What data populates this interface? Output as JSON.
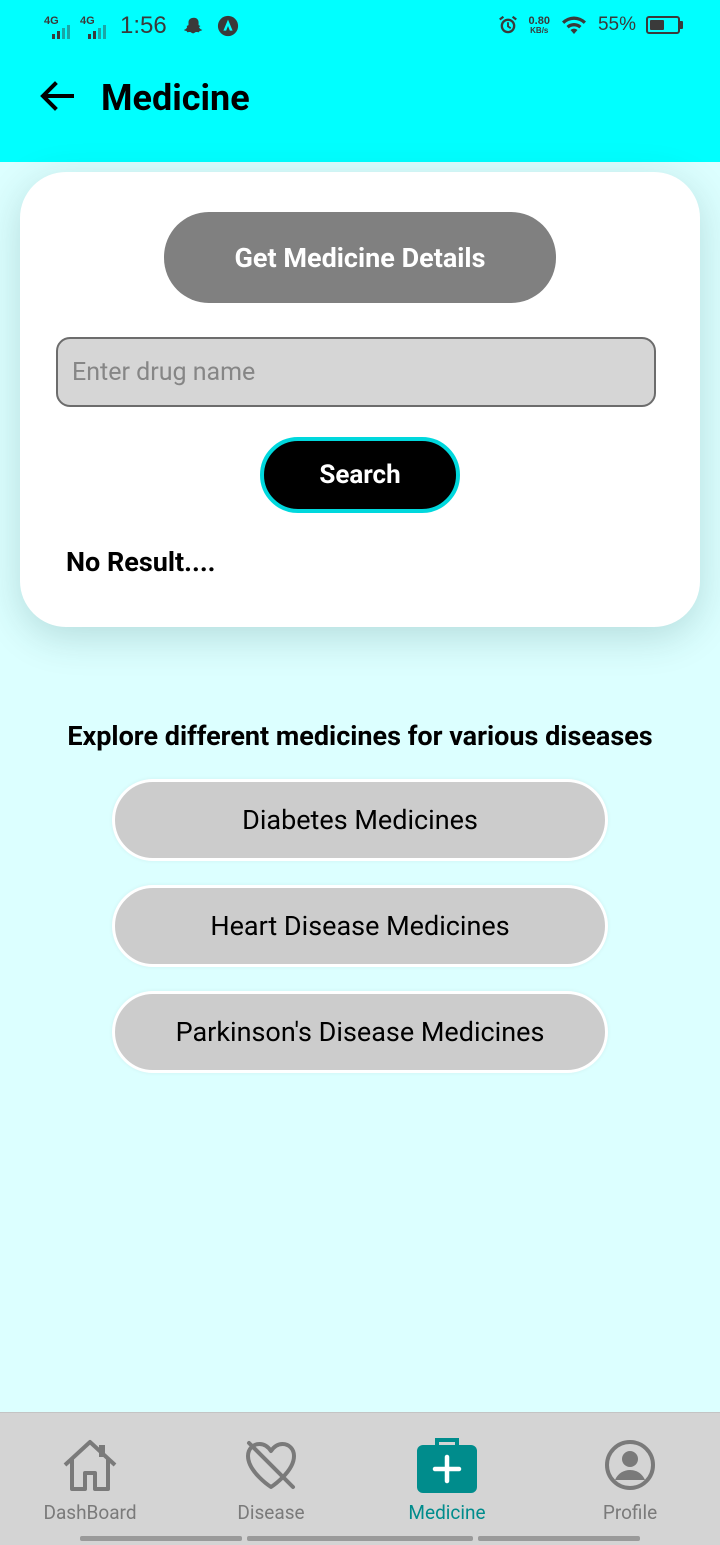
{
  "status_bar": {
    "network_1": "4G",
    "network_2": "4G",
    "time": "1:56",
    "net_speed_value": "0.80",
    "net_speed_unit": "KB/s",
    "battery_percent": "55%",
    "battery_level": 0.55
  },
  "header": {
    "title": "Medicine",
    "back_icon": "arrow-left-icon",
    "background_color": "#00ffff"
  },
  "search_card": {
    "details_button_label": "Get Medicine Details",
    "input_placeholder": "Enter drug name",
    "input_value": "",
    "search_button_label": "Search",
    "result_text": "No Result...."
  },
  "explore": {
    "heading": "Explore different medicines for various diseases",
    "buttons": [
      {
        "label": "Diabetes Medicines"
      },
      {
        "label": "Heart Disease Medicines"
      },
      {
        "label": "Parkinson's Disease Medicines"
      }
    ]
  },
  "bottom_nav": {
    "items": [
      {
        "label": "DashBoard",
        "icon": "home-icon",
        "active": false
      },
      {
        "label": "Disease",
        "icon": "heart-off-icon",
        "active": false
      },
      {
        "label": "Medicine",
        "icon": "medical-bag-icon",
        "active": true
      },
      {
        "label": "Profile",
        "icon": "account-circle-icon",
        "active": false
      }
    ],
    "active_color": "#008c8c"
  },
  "colors": {
    "page_background": "#dcffff",
    "header": "#00ffff",
    "details_button": "#808080",
    "search_button": "#000000",
    "search_button_border": "#00d8dd",
    "disease_button": "#cccccc"
  }
}
